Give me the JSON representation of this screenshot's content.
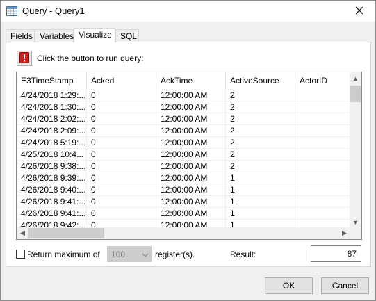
{
  "window": {
    "title": "Query - Query1"
  },
  "tabs": [
    {
      "label": "Fields"
    },
    {
      "label": "Variables"
    },
    {
      "label": "Visualize"
    },
    {
      "label": "SQL"
    }
  ],
  "run": {
    "label": "Click the button to run query:"
  },
  "grid": {
    "columns": [
      "E3TimeStamp",
      "Acked",
      "AckTime",
      "ActiveSource",
      "ActorID"
    ],
    "rows": [
      [
        "4/24/2018 1:29:...",
        "0",
        "12:00:00 AM",
        "2",
        ""
      ],
      [
        "4/24/2018 1:30:...",
        "0",
        "12:00:00 AM",
        "2",
        ""
      ],
      [
        "4/24/2018 2:02:...",
        "0",
        "12:00:00 AM",
        "2",
        ""
      ],
      [
        "4/24/2018 2:09:...",
        "0",
        "12:00:00 AM",
        "2",
        ""
      ],
      [
        "4/24/2018 5:19:...",
        "0",
        "12:00:00 AM",
        "2",
        ""
      ],
      [
        "4/25/2018 10:4...",
        "0",
        "12:00:00 AM",
        "2",
        ""
      ],
      [
        "4/26/2018 9:38:...",
        "0",
        "12:00:00 AM",
        "2",
        ""
      ],
      [
        "4/26/2018 9:39:...",
        "0",
        "12:00:00 AM",
        "1",
        ""
      ],
      [
        "4/26/2018 9:40:...",
        "0",
        "12:00:00 AM",
        "1",
        ""
      ],
      [
        "4/26/2018 9:41:...",
        "0",
        "12:00:00 AM",
        "1",
        ""
      ],
      [
        "4/26/2018 9:41:...",
        "0",
        "12:00:00 AM",
        "1",
        ""
      ],
      [
        "4/26/2018 9:42:...",
        "0",
        "12:00:00 AM",
        "1",
        ""
      ]
    ]
  },
  "options": {
    "return_max_label": "Return maximum of",
    "max_value": "100",
    "unit_label": "register(s).",
    "result_label": "Result:",
    "result_value": "87"
  },
  "buttons": {
    "ok": "OK",
    "cancel": "Cancel"
  },
  "colors": {
    "alert_red": "#cc1f1f",
    "window_bg": "#f0f0f0"
  },
  "icons": {
    "title": "table-window-icon",
    "run": "exclamation-alert-icon",
    "close": "close-icon"
  }
}
